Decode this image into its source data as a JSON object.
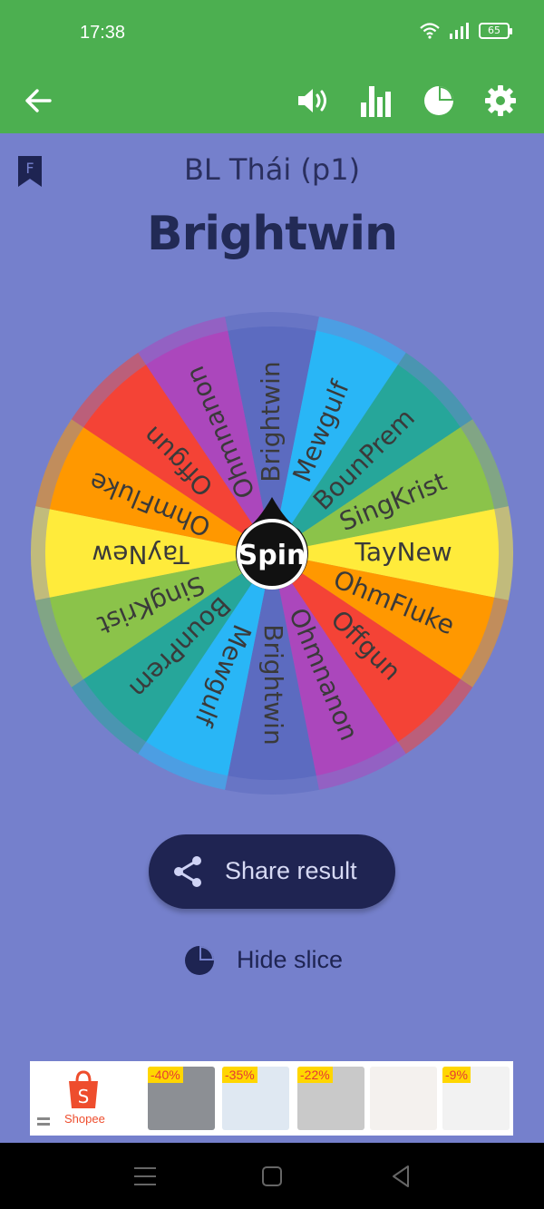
{
  "status_bar": {
    "time": "17:38",
    "battery": "65"
  },
  "app_bar": {
    "back_icon": "arrow-left-icon",
    "icons": [
      "volume-icon",
      "bar-chart-icon",
      "pie-chart-icon",
      "gear-icon"
    ]
  },
  "wheel_page": {
    "subtitle": "BL Thái (p1)",
    "result": "Brightwin",
    "spin_label": "Spin",
    "share_label": "Share result",
    "hide_slice_label": "Hide slice"
  },
  "wheel": {
    "slices": [
      {
        "label": "Brightwin",
        "color": "#5c6bc0"
      },
      {
        "label": "Mewgulf",
        "color": "#29b6f6"
      },
      {
        "label": "BounPrem",
        "color": "#26a69a"
      },
      {
        "label": "SingKrist",
        "color": "#8bc34a"
      },
      {
        "label": "TayNew",
        "color": "#ffeb3b"
      },
      {
        "label": "OhmFluke",
        "color": "#ff9800"
      },
      {
        "label": "Offgun",
        "color": "#f44336"
      },
      {
        "label": "Ohmnanon",
        "color": "#ab47bc"
      },
      {
        "label": "Brightwin",
        "color": "#5c6bc0"
      },
      {
        "label": "Mewgulf",
        "color": "#29b6f6"
      },
      {
        "label": "BounPrem",
        "color": "#26a69a"
      },
      {
        "label": "SingKrist",
        "color": "#8bc34a"
      },
      {
        "label": "TayNew",
        "color": "#ffeb3b"
      },
      {
        "label": "OhmFluke",
        "color": "#ff9800"
      },
      {
        "label": "Offgun",
        "color": "#f44336"
      },
      {
        "label": "Ohmnanon",
        "color": "#ab47bc"
      }
    ]
  },
  "ad": {
    "brand": "Shopee",
    "badges": [
      "-40%",
      "-35%",
      "-22%",
      "",
      "-9%"
    ]
  },
  "colors": {
    "accent": "#4caf50",
    "background": "#7580cc",
    "dark": "#1f2452"
  }
}
